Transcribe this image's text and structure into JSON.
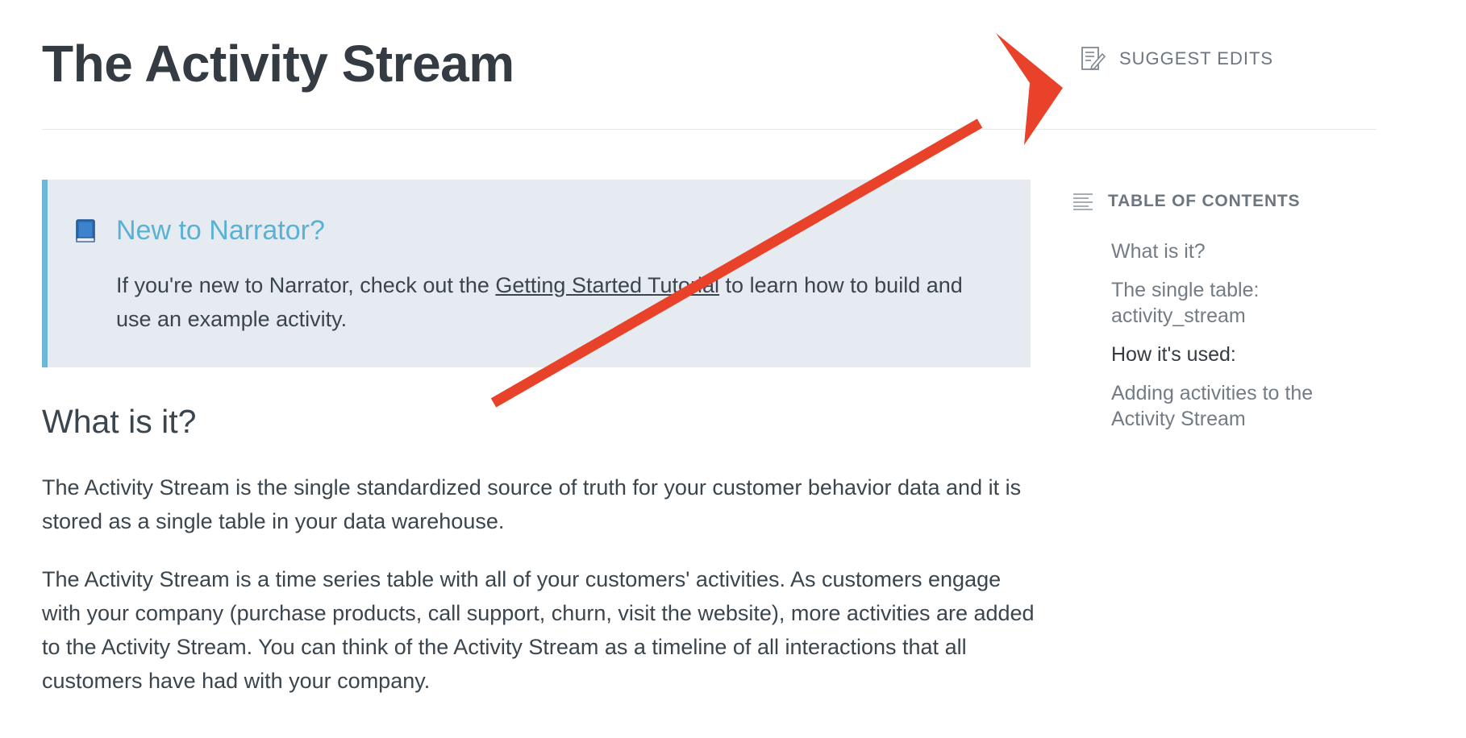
{
  "page": {
    "title": "The Activity Stream"
  },
  "suggest_edits": {
    "label": "SUGGEST EDITS",
    "icon": "edit-document-icon"
  },
  "callout": {
    "icon": "blue-book-icon",
    "title": "New to Narrator?",
    "text_before": "If you're new to Narrator, check out the ",
    "link_text": "Getting Started Tutorial",
    "text_after": " to learn how to build and use an example activity.",
    "accent_color": "#6db8d8",
    "background_color": "#e5ebf0"
  },
  "content": {
    "heading": "What is it?",
    "paragraph_1": "The Activity Stream is the single standardized source of truth for your customer behavior data and it is stored as a single table in your data warehouse.",
    "paragraph_2": "The Activity Stream is a time series table with all of your customers' activities. As customers engage with your company (purchase products, call support, churn, visit the website), more activities are added to the Activity Stream. You can think of the Activity Stream as a timeline of all interactions that all customers have had with your company."
  },
  "toc": {
    "title": "TABLE OF CONTENTS",
    "icon": "list-lines-icon",
    "items": [
      {
        "label": "What is it?"
      },
      {
        "label": "The single table: activity_stream"
      },
      {
        "label": "How it's used:"
      },
      {
        "label": "Adding activities to the Activity Stream"
      }
    ],
    "active_index": 2
  },
  "annotation": {
    "type": "arrow",
    "color": "#e8432a",
    "points_to": "suggest-edits-button"
  }
}
